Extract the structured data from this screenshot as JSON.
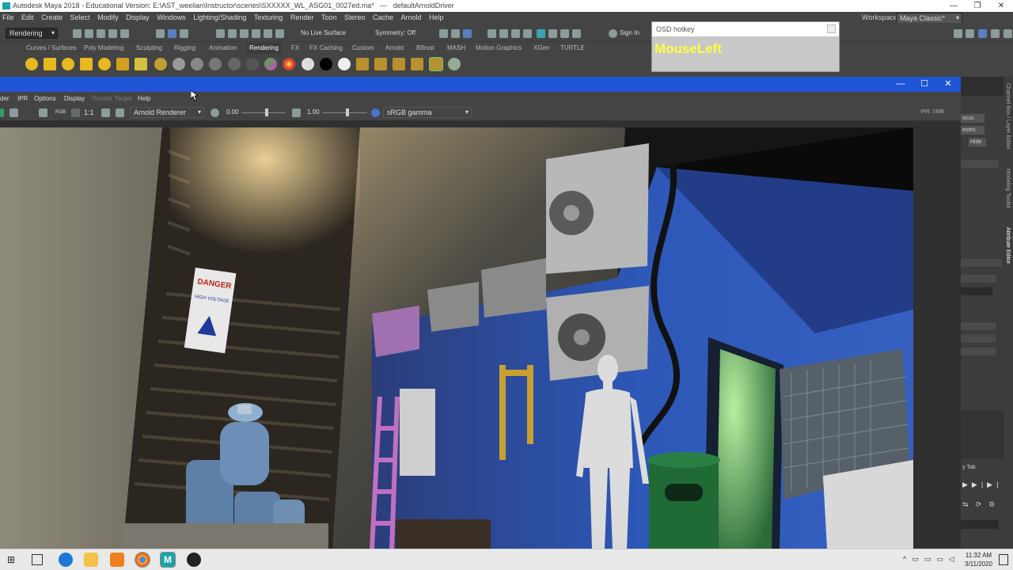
{
  "maya_window": {
    "title": "Autodesk Maya 2018 - Educational Version: E:\\AST_weelian\\Instructor\\scenes\\SXXXXX_WL_ASG01_0027ed.ma*   ---   defaultArnoldDriver",
    "workspace_label": "Workspace :",
    "workspace_value": "Maya Classic*"
  },
  "menu": [
    "File",
    "Edit",
    "Create",
    "Select",
    "Modify",
    "Display",
    "Windows",
    "Lighting/Shading",
    "Texturing",
    "Render",
    "Toon",
    "Stereo",
    "Cache",
    "Arnold",
    "Help"
  ],
  "status_line": {
    "menuset": "Rendering",
    "live_surface": "No Live Surface",
    "symmetry": "Symmetry: Off",
    "sign_in": "Sign In"
  },
  "shelf_tabs": [
    "Curves / Surfaces",
    "Poly Modeling",
    "Sculpting",
    "Rigging",
    "Animation",
    "Rendering",
    "FX",
    "FX Caching",
    "Custom",
    "Arnold",
    "Bifrost",
    "MASH",
    "Motion Graphics",
    "XGen",
    "TURTLE"
  ],
  "active_shelf_tab": "Rendering",
  "osd": {
    "header": "OSD hotkey",
    "text": "MouseLeft"
  },
  "render_view": {
    "menu": [
      "der",
      "IPR",
      "Options",
      "Display",
      "Render Target",
      "Help"
    ],
    "ratio": "1:1",
    "renderer": "Arnold Renderer",
    "exposure": "0.00",
    "gamma": "1.00",
    "color_space": "sRGB gamma",
    "ipr_mem": "IPR: 0MB"
  },
  "right_panel": {
    "buttons": [
      "ocus",
      "esets",
      "Hide",
      "y Tab"
    ],
    "vertical_labels": [
      "Channel Box / Layer Editor",
      "Modeling Toolkit",
      "Attribute Editor"
    ]
  },
  "scene_text": {
    "danger": "DANGER",
    "high_voltage": "HIGH VOLTAGE"
  },
  "taskbar": {
    "time": "11:32 AM",
    "date": "3/11/2020"
  },
  "colors": {
    "accent_blue": "#1f56d6",
    "osd_text": "#ffff40",
    "maya_teal": "#1aa2a8"
  }
}
